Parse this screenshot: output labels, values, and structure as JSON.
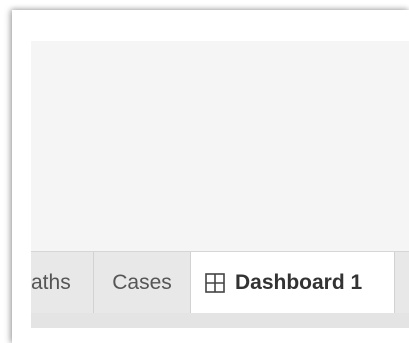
{
  "tabs": {
    "items": [
      {
        "label": "aths",
        "active": false
      },
      {
        "label": "Cases",
        "active": false
      },
      {
        "label": "Dashboard 1",
        "active": true,
        "icon": "dashboard-grid-icon"
      }
    ]
  },
  "colors": {
    "canvas_background": "#f5f5f5",
    "tab_strip_background": "#e8e8e8",
    "active_tab_background": "#ffffff",
    "tab_text": "#555555",
    "active_tab_text": "#333333"
  }
}
